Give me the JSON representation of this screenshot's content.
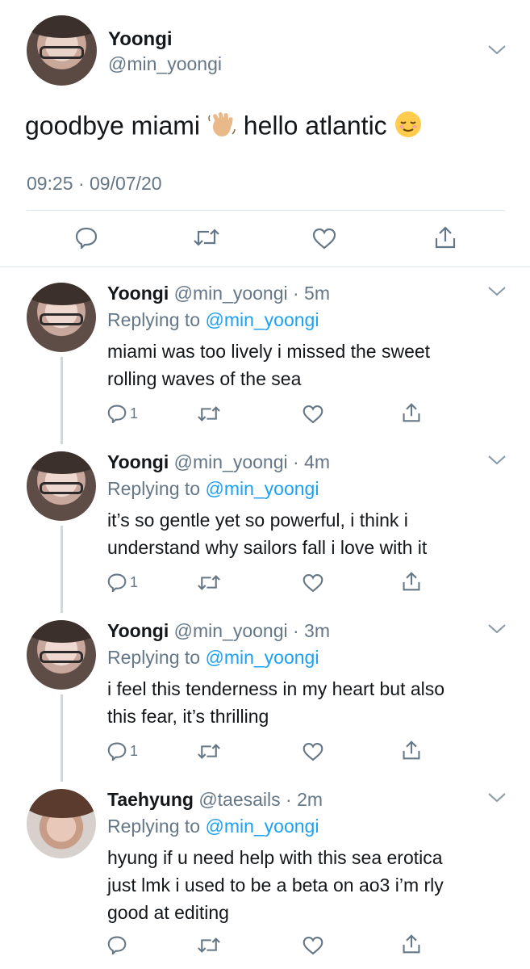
{
  "main": {
    "name": "Yoongi",
    "handle": "@min_yoongi",
    "text_part1": "goodbye miami ",
    "text_part2": " hello atlantic ",
    "time": "09:25 · 09/07/20"
  },
  "replies": [
    {
      "name": "Yoongi",
      "meta": "@min_yoongi · 5m",
      "replying_label": "Replying to ",
      "replying_to": "@min_yoongi",
      "line1": "miami was too lively i missed the sweet",
      "line2": "rolling waves of the sea",
      "line3": "",
      "reply_count": "1"
    },
    {
      "name": "Yoongi",
      "meta": "@min_yoongi · 4m",
      "replying_label": "Replying to ",
      "replying_to": "@min_yoongi",
      "line1": "it’s so gentle yet so powerful, i think i",
      "line2": "understand why sailors fall i love with it",
      "line3": "",
      "reply_count": "1"
    },
    {
      "name": "Yoongi",
      "meta": "@min_yoongi · 3m",
      "replying_label": "Replying to ",
      "replying_to": "@min_yoongi",
      "line1": "i feel this tenderness in my heart but also",
      "line2": "this fear, it’s thrilling",
      "line3": "",
      "reply_count": "1"
    },
    {
      "name": "Taehyung",
      "meta": "@taesails · 2m",
      "replying_label": "Replying to ",
      "replying_to": "@min_yoongi",
      "line1": "hyung if u need help with this sea erotica",
      "line2": "just lmk i used to be a beta on ao3 i’m rly",
      "line3": "good at editing",
      "reply_count": ""
    }
  ],
  "icons": {
    "reply": "reply-icon",
    "retweet": "retweet-icon",
    "like": "heart-icon",
    "share": "share-icon",
    "chevron": "chevron-down-icon"
  },
  "colors": {
    "link": "#1da1f2",
    "secondary_text": "#657786",
    "divider": "#e1e8ed"
  }
}
